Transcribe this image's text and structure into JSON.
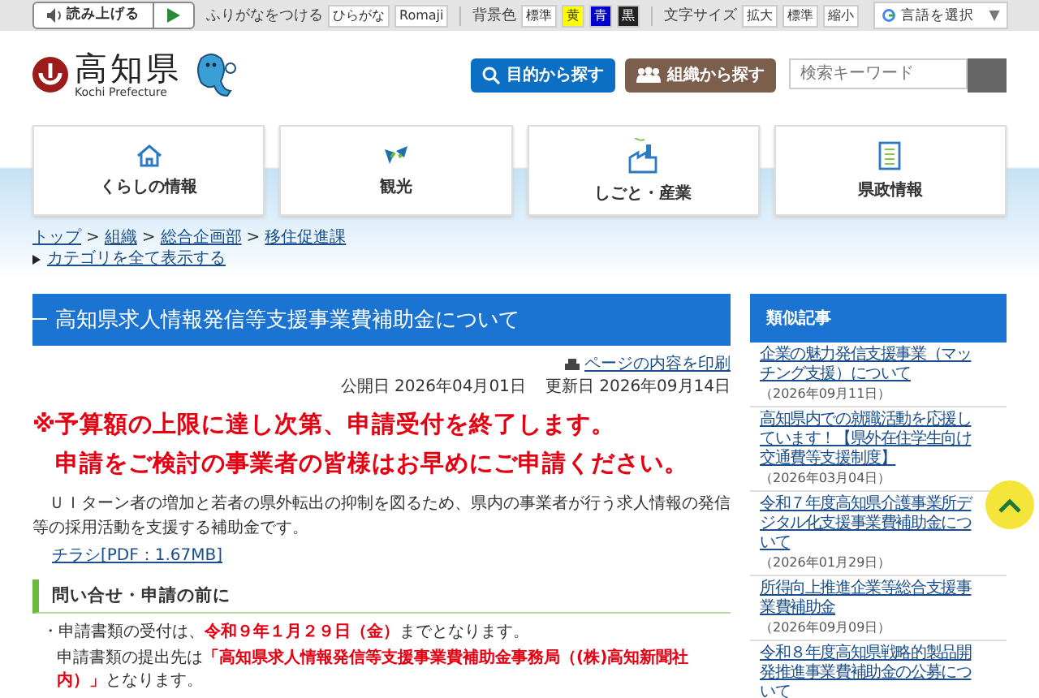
{
  "toolbar": {
    "read_aloud": "読み上げる",
    "furigana_label": "ふりがなをつける",
    "furigana_options": [
      "ひらがな",
      "Romaji"
    ],
    "bg_label": "背景色",
    "bg_options": [
      {
        "label": "標準",
        "color": "#ffffff"
      },
      {
        "label": "黄",
        "color": "#ffff00"
      },
      {
        "label": "青",
        "color": "#0000cc"
      },
      {
        "label": "黒",
        "color": "#222222"
      }
    ],
    "size_label": "文字サイズ",
    "size_options": [
      "拡大",
      "標準",
      "縮小"
    ],
    "language": "言語を選択",
    "language_caret": "▼"
  },
  "header": {
    "logo_text": "高知県",
    "logo_sub": "Kochi Prefecture",
    "buttons": [
      {
        "label": "目的から探す",
        "kind": "search",
        "color": "#0b6fc3"
      },
      {
        "label": "組織から探す",
        "kind": "people",
        "color": "#7b5e4b"
      }
    ],
    "search_placeholder": "検索キーワード"
  },
  "nav": [
    {
      "label": "くらしの情報",
      "kind": "home"
    },
    {
      "label": "観光",
      "kind": "tourism"
    },
    {
      "label": "しごと・産業",
      "kind": "factory"
    },
    {
      "label": "県政情報",
      "kind": "document"
    }
  ],
  "breadcrumb": [
    {
      "kind": "link",
      "text": "トップ"
    },
    {
      "kind": "sep",
      "text": ">"
    },
    {
      "kind": "link",
      "text": "組織"
    },
    {
      "kind": "sep",
      "text": ">"
    },
    {
      "kind": "link",
      "text": "総合企画部"
    },
    {
      "kind": "sep",
      "text": ">"
    },
    {
      "kind": "link",
      "text": "移住促進課"
    }
  ],
  "category_link": "カテゴリを全て表示する",
  "article": {
    "title": "高知県求人情報発信等支援事業費補助金について",
    "print_link": "ページの内容を印刷",
    "published": "公開日 2026年04月01日",
    "updated": "更新日 2026年09月14日",
    "notices": [
      "※予算額の上限に達し次第、申請受付を終了します。",
      "申請をご検討の事業者の皆様はお早めにご申請ください。"
    ],
    "body": "ＵＩターン者の増加と若者の県外転出の抑制を図るため、県内の事業者が行う求人情報の発信等の採用活動を支援する補助金です。",
    "pdf_link": "チラシ[PDF：1.67MB]",
    "section_heading": "問い合せ・申請の前に",
    "items": [
      "・申請書類の受付は、**令和９年１月２９日（金）**までとなります。",
      "申請書類の提出先は**「高知県求人情報発信等支援事業費補助金事務局（(株)高知新聞社内）」**となります。"
    ]
  },
  "sidebar": {
    "title": "類似記事",
    "articles": [
      {
        "title": "企業の魅力発信支援事業（マッチング支援）について",
        "date": "（2026年09月11日）"
      },
      {
        "title": "高知県内での就職活動を応援しています！【県外在住学生向け交通費等支援制度】",
        "date": "（2026年03月04日）"
      },
      {
        "title": "令和７年度高知県介護事業所デジタル化支援事業費補助金について",
        "date": "（2026年01月29日）"
      },
      {
        "title": "所得向上推進企業等総合支援事業費補助金",
        "date": "（2026年09月09日）"
      },
      {
        "title": "令和８年度高知県戦略的製品開発推進事業費補助金の公募について"
      }
    ]
  }
}
